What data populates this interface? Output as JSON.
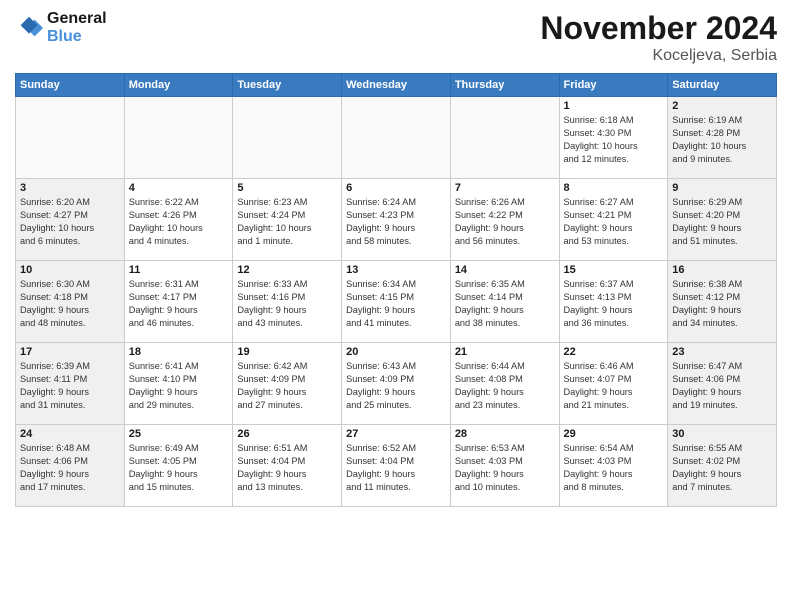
{
  "logo": {
    "line1": "General",
    "line2": "Blue"
  },
  "title": "November 2024",
  "location": "Koceljeva, Serbia",
  "days_of_week": [
    "Sunday",
    "Monday",
    "Tuesday",
    "Wednesday",
    "Thursday",
    "Friday",
    "Saturday"
  ],
  "weeks": [
    [
      {
        "day": "",
        "type": "empty",
        "info": ""
      },
      {
        "day": "",
        "type": "empty",
        "info": ""
      },
      {
        "day": "",
        "type": "empty",
        "info": ""
      },
      {
        "day": "",
        "type": "empty",
        "info": ""
      },
      {
        "day": "",
        "type": "empty",
        "info": ""
      },
      {
        "day": "1",
        "type": "weekend",
        "info": "Sunrise: 6:18 AM\nSunset: 4:30 PM\nDaylight: 10 hours\nand 12 minutes."
      },
      {
        "day": "2",
        "type": "weekend",
        "info": "Sunrise: 6:19 AM\nSunset: 4:28 PM\nDaylight: 10 hours\nand 9 minutes."
      }
    ],
    [
      {
        "day": "3",
        "type": "weekend",
        "info": "Sunrise: 6:20 AM\nSunset: 4:27 PM\nDaylight: 10 hours\nand 6 minutes."
      },
      {
        "day": "4",
        "type": "weekday",
        "info": "Sunrise: 6:22 AM\nSunset: 4:26 PM\nDaylight: 10 hours\nand 4 minutes."
      },
      {
        "day": "5",
        "type": "weekday",
        "info": "Sunrise: 6:23 AM\nSunset: 4:24 PM\nDaylight: 10 hours\nand 1 minute."
      },
      {
        "day": "6",
        "type": "weekday",
        "info": "Sunrise: 6:24 AM\nSunset: 4:23 PM\nDaylight: 9 hours\nand 58 minutes."
      },
      {
        "day": "7",
        "type": "weekday",
        "info": "Sunrise: 6:26 AM\nSunset: 4:22 PM\nDaylight: 9 hours\nand 56 minutes."
      },
      {
        "day": "8",
        "type": "weekend",
        "info": "Sunrise: 6:27 AM\nSunset: 4:21 PM\nDaylight: 9 hours\nand 53 minutes."
      },
      {
        "day": "9",
        "type": "weekend",
        "info": "Sunrise: 6:29 AM\nSunset: 4:20 PM\nDaylight: 9 hours\nand 51 minutes."
      }
    ],
    [
      {
        "day": "10",
        "type": "weekend",
        "info": "Sunrise: 6:30 AM\nSunset: 4:18 PM\nDaylight: 9 hours\nand 48 minutes."
      },
      {
        "day": "11",
        "type": "weekday",
        "info": "Sunrise: 6:31 AM\nSunset: 4:17 PM\nDaylight: 9 hours\nand 46 minutes."
      },
      {
        "day": "12",
        "type": "weekday",
        "info": "Sunrise: 6:33 AM\nSunset: 4:16 PM\nDaylight: 9 hours\nand 43 minutes."
      },
      {
        "day": "13",
        "type": "weekday",
        "info": "Sunrise: 6:34 AM\nSunset: 4:15 PM\nDaylight: 9 hours\nand 41 minutes."
      },
      {
        "day": "14",
        "type": "weekday",
        "info": "Sunrise: 6:35 AM\nSunset: 4:14 PM\nDaylight: 9 hours\nand 38 minutes."
      },
      {
        "day": "15",
        "type": "weekend",
        "info": "Sunrise: 6:37 AM\nSunset: 4:13 PM\nDaylight: 9 hours\nand 36 minutes."
      },
      {
        "day": "16",
        "type": "weekend",
        "info": "Sunrise: 6:38 AM\nSunset: 4:12 PM\nDaylight: 9 hours\nand 34 minutes."
      }
    ],
    [
      {
        "day": "17",
        "type": "weekend",
        "info": "Sunrise: 6:39 AM\nSunset: 4:11 PM\nDaylight: 9 hours\nand 31 minutes."
      },
      {
        "day": "18",
        "type": "weekday",
        "info": "Sunrise: 6:41 AM\nSunset: 4:10 PM\nDaylight: 9 hours\nand 29 minutes."
      },
      {
        "day": "19",
        "type": "weekday",
        "info": "Sunrise: 6:42 AM\nSunset: 4:09 PM\nDaylight: 9 hours\nand 27 minutes."
      },
      {
        "day": "20",
        "type": "weekday",
        "info": "Sunrise: 6:43 AM\nSunset: 4:09 PM\nDaylight: 9 hours\nand 25 minutes."
      },
      {
        "day": "21",
        "type": "weekday",
        "info": "Sunrise: 6:44 AM\nSunset: 4:08 PM\nDaylight: 9 hours\nand 23 minutes."
      },
      {
        "day": "22",
        "type": "weekend",
        "info": "Sunrise: 6:46 AM\nSunset: 4:07 PM\nDaylight: 9 hours\nand 21 minutes."
      },
      {
        "day": "23",
        "type": "weekend",
        "info": "Sunrise: 6:47 AM\nSunset: 4:06 PM\nDaylight: 9 hours\nand 19 minutes."
      }
    ],
    [
      {
        "day": "24",
        "type": "weekend",
        "info": "Sunrise: 6:48 AM\nSunset: 4:06 PM\nDaylight: 9 hours\nand 17 minutes."
      },
      {
        "day": "25",
        "type": "weekday",
        "info": "Sunrise: 6:49 AM\nSunset: 4:05 PM\nDaylight: 9 hours\nand 15 minutes."
      },
      {
        "day": "26",
        "type": "weekday",
        "info": "Sunrise: 6:51 AM\nSunset: 4:04 PM\nDaylight: 9 hours\nand 13 minutes."
      },
      {
        "day": "27",
        "type": "weekday",
        "info": "Sunrise: 6:52 AM\nSunset: 4:04 PM\nDaylight: 9 hours\nand 11 minutes."
      },
      {
        "day": "28",
        "type": "weekday",
        "info": "Sunrise: 6:53 AM\nSunset: 4:03 PM\nDaylight: 9 hours\nand 10 minutes."
      },
      {
        "day": "29",
        "type": "weekend",
        "info": "Sunrise: 6:54 AM\nSunset: 4:03 PM\nDaylight: 9 hours\nand 8 minutes."
      },
      {
        "day": "30",
        "type": "weekend",
        "info": "Sunrise: 6:55 AM\nSunset: 4:02 PM\nDaylight: 9 hours\nand 7 minutes."
      }
    ]
  ]
}
